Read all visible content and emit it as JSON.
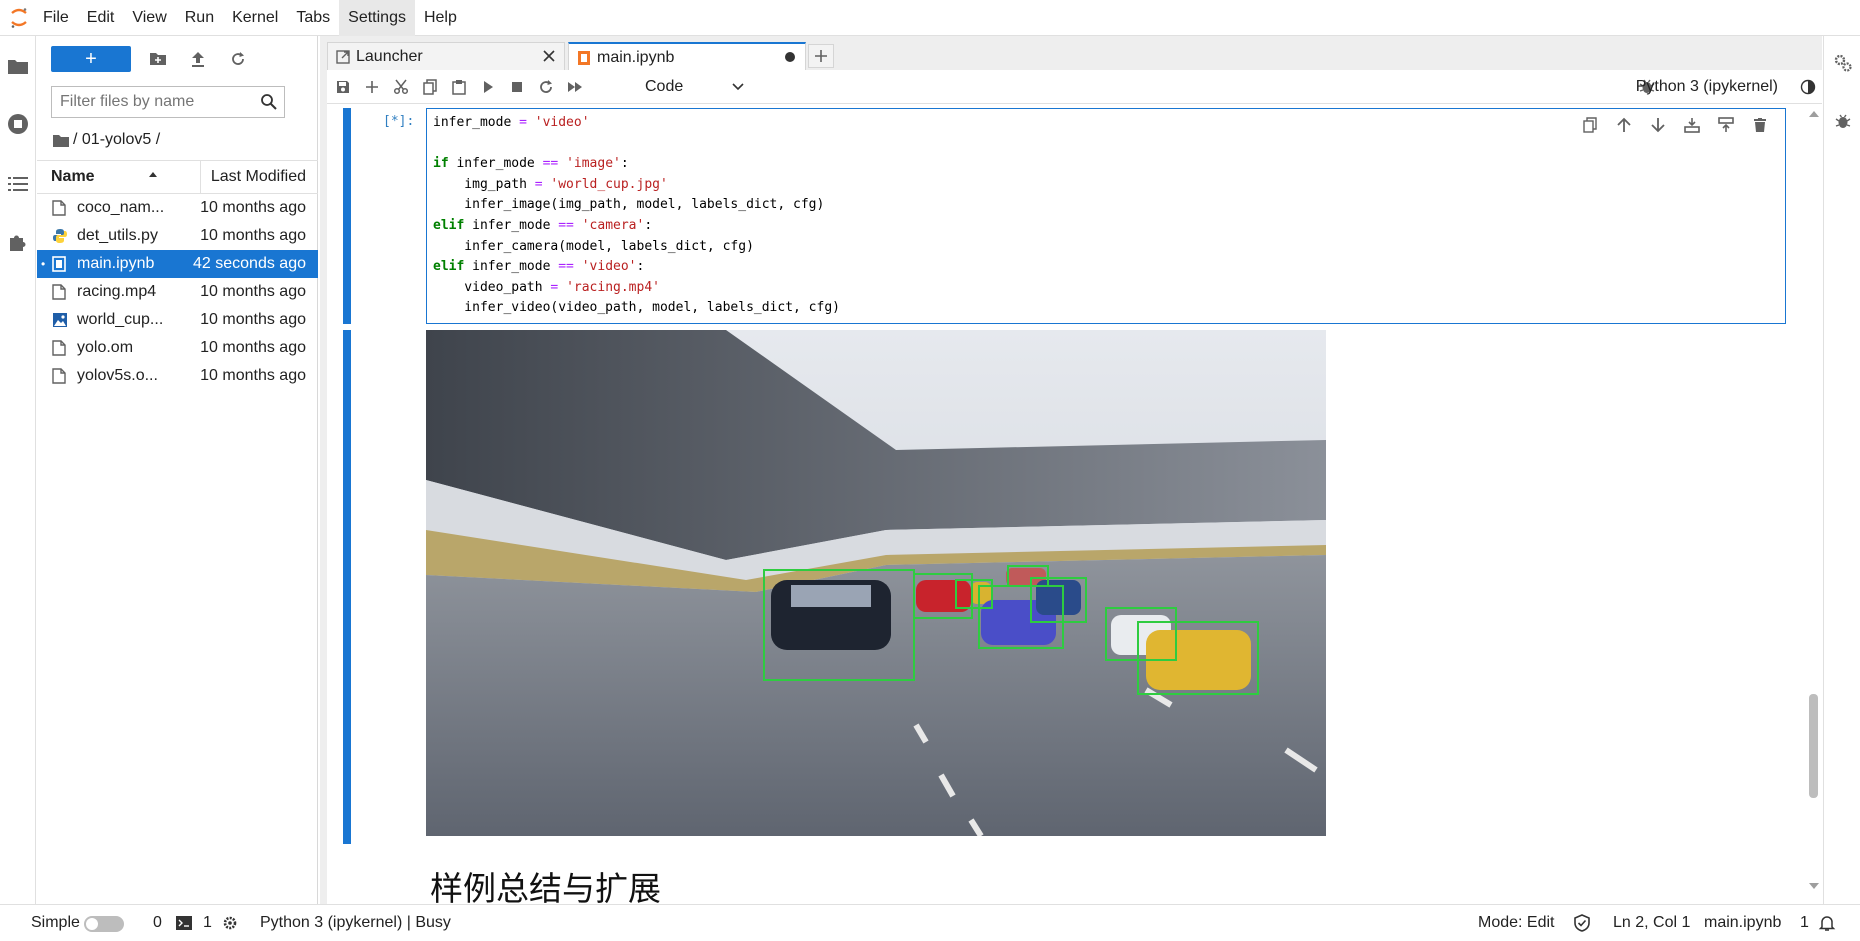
{
  "menu": [
    "File",
    "Edit",
    "View",
    "Run",
    "Kernel",
    "Tabs",
    "Settings",
    "Help"
  ],
  "menu_active": "Settings",
  "filebrowser": {
    "new_label": "+",
    "filter_placeholder": "Filter files by name",
    "breadcrumb": "/ 01-yolov5 /",
    "col_name": "Name",
    "col_modified": "Last Modified",
    "files": [
      {
        "name": "coco_nam...",
        "modified": "10 months ago",
        "icon": "file-icon"
      },
      {
        "name": "det_utils.py",
        "modified": "10 months ago",
        "icon": "python-icon"
      },
      {
        "name": "main.ipynb",
        "modified": "42 seconds ago",
        "icon": "notebook-icon",
        "selected": true
      },
      {
        "name": "racing.mp4",
        "modified": "10 months ago",
        "icon": "file-icon"
      },
      {
        "name": "world_cup...",
        "modified": "10 months ago",
        "icon": "image-icon"
      },
      {
        "name": "yolo.om",
        "modified": "10 months ago",
        "icon": "file-icon"
      },
      {
        "name": "yolov5s.o...",
        "modified": "10 months ago",
        "icon": "file-icon"
      }
    ]
  },
  "tabs": [
    {
      "label": "Launcher",
      "icon": "launcher-icon"
    },
    {
      "label": "main.ipynb",
      "icon": "notebook-icon",
      "active": true,
      "unsaved": true
    }
  ],
  "toolbar": {
    "cell_type": "Code",
    "kernel": "Python 3 (ipykernel)"
  },
  "cell": {
    "prompt": "[*]:",
    "code_lines": [
      "infer_mode = 'video'",
      "",
      "if infer_mode == 'image':",
      "    img_path = 'world_cup.jpg'",
      "    infer_image(img_path, model, labels_dict, cfg)",
      "elif infer_mode == 'camera':",
      "    infer_camera(model, labels_dict, cfg)",
      "elif infer_mode == 'video':",
      "    video_path = 'racing.mp4'",
      "    infer_video(video_path, model, labels_dict, cfg)"
    ]
  },
  "markdown_heading": "样例总结与扩展",
  "statusbar": {
    "mode_label": "Simple",
    "terminals": "0",
    "kernels": "1",
    "kernel_status": "Python 3 (ipykernel) | Busy",
    "edit_mode": "Mode: Edit",
    "cursor": "Ln 2, Col 1",
    "file": "main.ipynb",
    "notifications": "1"
  },
  "colors": {
    "accent": "#1976d2",
    "detection_box": "#2ecc40"
  }
}
